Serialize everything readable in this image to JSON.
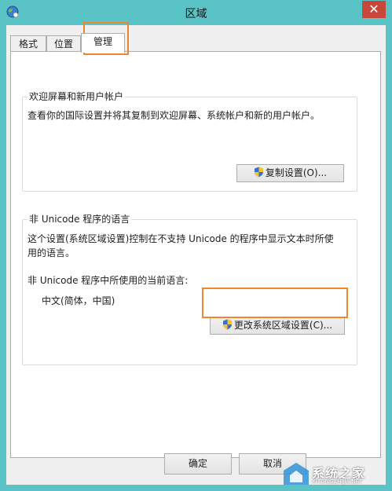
{
  "window": {
    "title": "区域",
    "close_glyph": "✕"
  },
  "tabs": [
    {
      "label": "格式"
    },
    {
      "label": "位置"
    },
    {
      "label": "管理",
      "active": true
    }
  ],
  "welcome_group": {
    "title": "欢迎屏幕和新用户帐户",
    "description": "查看你的国际设置并将其复制到欢迎屏幕、系统帐户和新的用户帐户。",
    "button_label": "复制设置(O)..."
  },
  "unicode_group": {
    "title": "非 Unicode 程序的语言",
    "description_line1": "这个设置(系统区域设置)控制在不支持 Unicode 的程序中显示文本时所使",
    "description_line2": "用的语言。",
    "current_label": "非 Unicode 程序中所使用的当前语言:",
    "current_value": "中文(简体，中国)",
    "button_label": "更改系统区域设置(C)..."
  },
  "footer": {
    "ok_label": "确定",
    "cancel_label": "取消"
  },
  "watermark": {
    "text": "系统之家",
    "sub": "XITONGZHIJIA.NET"
  },
  "colors": {
    "highlight": "#f0872a",
    "titlebar": "#5ac3c6",
    "close": "#c7483a"
  }
}
